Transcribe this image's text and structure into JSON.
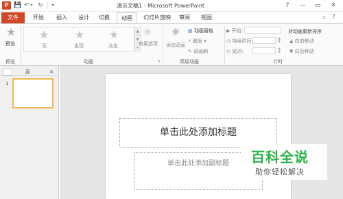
{
  "window": {
    "title": "演示文稿1 - Microsoft PowerPoint",
    "logo_letter": "P",
    "controls": {
      "help": "?",
      "minimize": "—",
      "restore": "▭",
      "close": "✕"
    }
  },
  "quick_access": {
    "save": "💾",
    "undo": "↶",
    "undo_dropdown": "▾",
    "redo": "↻",
    "customize": "▾"
  },
  "tabs": [
    {
      "label": "文件"
    },
    {
      "label": "开始"
    },
    {
      "label": "插入"
    },
    {
      "label": "设计"
    },
    {
      "label": "切换"
    },
    {
      "label": "动画"
    },
    {
      "label": "幻灯片放映"
    },
    {
      "label": "审阅"
    },
    {
      "label": "视图"
    }
  ],
  "tab_bar_icons": {
    "collapse": "▵",
    "help": "?"
  },
  "ribbon": {
    "preview_group": {
      "button_label": "预览",
      "group_label": "预览",
      "icon": "★"
    },
    "animation_group": {
      "items": [
        {
          "label": "无",
          "icon": "★"
        },
        {
          "label": "出现",
          "icon": "★"
        },
        {
          "label": "淡出",
          "icon": "★"
        }
      ],
      "effect_options_label": "效果选项",
      "group_label": "动画",
      "launcher": "↘"
    },
    "advanced_group": {
      "add_animation_label": "添加动画",
      "pane_label": "动画窗格",
      "trigger_label": "触发",
      "painter_label": "动画刷",
      "group_label": "高级动画"
    },
    "timing_group": {
      "start_label": "开始:",
      "duration_label": "持续时间:",
      "delay_label": "延迟:",
      "reorder_title": "对动画重新排序",
      "move_earlier_label": "向前移动",
      "move_later_label": "向后移动",
      "group_label": "计时"
    }
  },
  "left_pane": {
    "tab_slides": "",
    "tab_outline": "源",
    "close": "✕",
    "thumb_number": "1"
  },
  "slide": {
    "title_placeholder": "单击此处添加标题",
    "subtitle_placeholder": "单击此处添加副标题"
  },
  "watermark": {
    "title": "百科全说",
    "subtitle": "助你轻松解决"
  },
  "colors": {
    "accent": "#d24625",
    "thumb_border": "#f0b94f",
    "watermark_green": "#2db34a"
  }
}
